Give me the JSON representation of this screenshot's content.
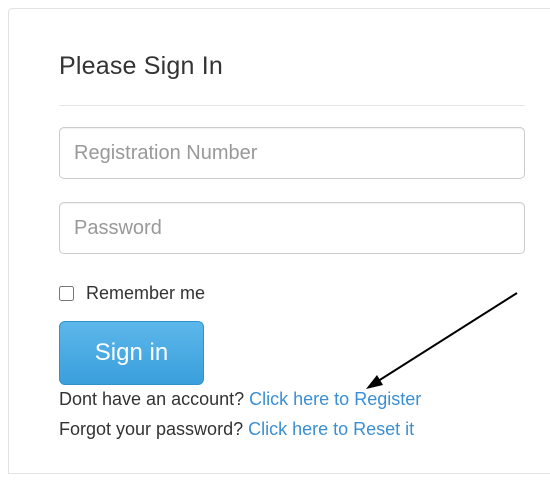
{
  "form": {
    "title": "Please Sign In",
    "registration_placeholder": "Registration Number",
    "password_placeholder": "Password",
    "remember_label": "Remember me",
    "signin_label": "Sign in",
    "register_prompt": "Dont have an account?",
    "register_link": "Click here to Register",
    "forgot_prompt": "Forgot your password?",
    "reset_link": "Click here to Reset it"
  },
  "colors": {
    "link": "#3a8fd3",
    "button": "#3a9fdc"
  }
}
